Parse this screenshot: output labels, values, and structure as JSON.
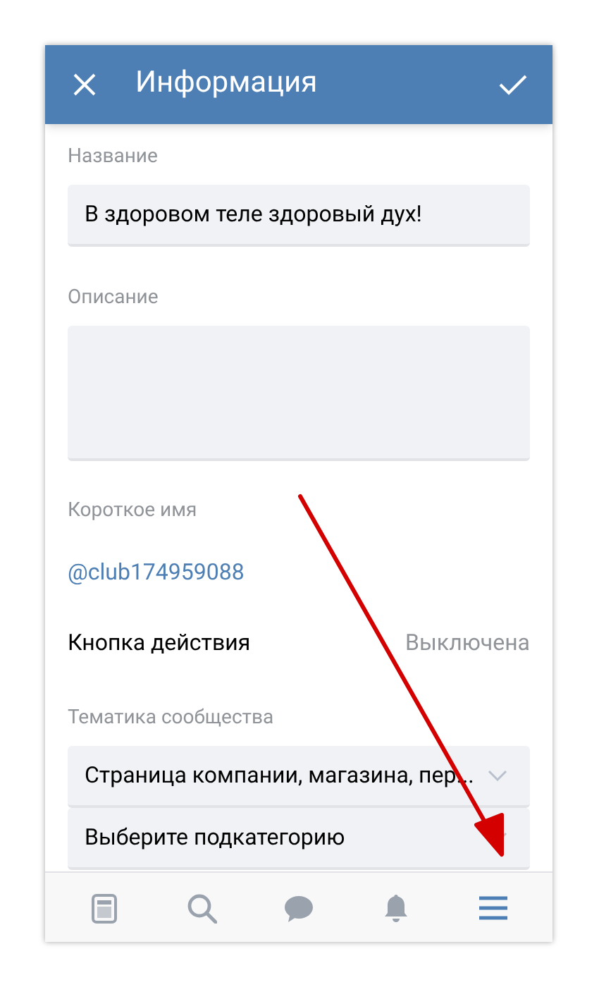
{
  "header": {
    "title": "Информация"
  },
  "fields": [
    {
      "kind": "input",
      "label": "Название",
      "value": "В здоровом теле здоровый дух!"
    },
    {
      "kind": "textarea",
      "label": "Описание"
    }
  ],
  "short_name": {
    "label": "Короткое имя",
    "value": "@club174959088"
  },
  "action_button": {
    "label": "Кнопка действия",
    "value": "Выключена"
  },
  "topic": {
    "label": "Тематика сообщества",
    "selects": [
      "Страница компании, магазина, пер...",
      "Выберите подкатегорию"
    ]
  },
  "nav": [
    {
      "selected": false
    },
    {
      "selected": false
    },
    {
      "selected": false
    },
    {
      "selected": false
    },
    {
      "selected": true
    }
  ]
}
